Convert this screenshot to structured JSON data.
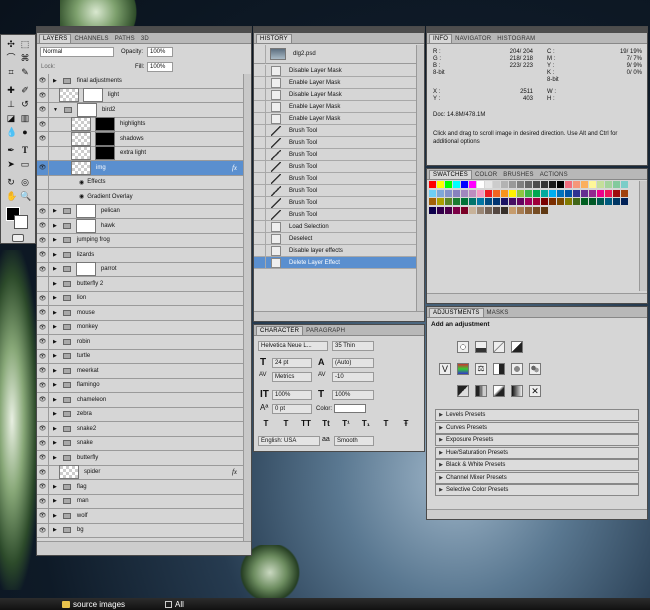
{
  "layers_panel": {
    "tabs": [
      "LAYERS",
      "CHANNELS",
      "PATHS",
      "3D"
    ],
    "blend_mode": "Normal",
    "opacity_label": "Opacity:",
    "opacity_value": "100%",
    "lock_label": "Lock:",
    "fill_label": "Fill:",
    "fill_value": "100%",
    "layers": [
      {
        "name": "final adjustments",
        "type": "group"
      },
      {
        "name": "light",
        "type": "layer-mask"
      },
      {
        "name": "bird2",
        "type": "group-open"
      },
      {
        "name": "highlights",
        "type": "sub-mask"
      },
      {
        "name": "shadows",
        "type": "sub-mask"
      },
      {
        "name": "extra light",
        "type": "sub-mask"
      },
      {
        "name": "img",
        "type": "selected"
      },
      {
        "name": "Effects",
        "type": "effect"
      },
      {
        "name": "Gradient Overlay",
        "type": "effect2"
      },
      {
        "name": "pelican",
        "type": "group-mask"
      },
      {
        "name": "hawk",
        "type": "group-mask"
      },
      {
        "name": "jumping frog",
        "type": "group"
      },
      {
        "name": "lizards",
        "type": "group"
      },
      {
        "name": "parrot",
        "type": "group-mask"
      },
      {
        "name": "butterfly 2",
        "type": "group"
      },
      {
        "name": "lion",
        "type": "group"
      },
      {
        "name": "mouse",
        "type": "group"
      },
      {
        "name": "monkey",
        "type": "group"
      },
      {
        "name": "robin",
        "type": "group"
      },
      {
        "name": "turtle",
        "type": "group"
      },
      {
        "name": "meerkat",
        "type": "group"
      },
      {
        "name": "flamingo",
        "type": "group"
      },
      {
        "name": "chameleon",
        "type": "group"
      },
      {
        "name": "zebra",
        "type": "group"
      },
      {
        "name": "snake2",
        "type": "group"
      },
      {
        "name": "snake",
        "type": "group"
      },
      {
        "name": "butterfly",
        "type": "group"
      },
      {
        "name": "spider",
        "type": "layer-fx"
      },
      {
        "name": "flag",
        "type": "group"
      },
      {
        "name": "man",
        "type": "group"
      },
      {
        "name": "wolf",
        "type": "group"
      },
      {
        "name": "bg",
        "type": "group"
      }
    ],
    "fx_label": "fx"
  },
  "history_panel": {
    "tab": "HISTORY",
    "snapshot": "dlg2.psd",
    "items": [
      {
        "label": "Disable Layer Mask",
        "icon": "doc"
      },
      {
        "label": "Enable Layer Mask",
        "icon": "doc"
      },
      {
        "label": "Disable Layer Mask",
        "icon": "doc"
      },
      {
        "label": "Enable Layer Mask",
        "icon": "doc"
      },
      {
        "label": "Enable Layer Mask",
        "icon": "doc"
      },
      {
        "label": "Brush Tool",
        "icon": "brush"
      },
      {
        "label": "Brush Tool",
        "icon": "brush"
      },
      {
        "label": "Brush Tool",
        "icon": "brush"
      },
      {
        "label": "Brush Tool",
        "icon": "brush"
      },
      {
        "label": "Brush Tool",
        "icon": "brush"
      },
      {
        "label": "Brush Tool",
        "icon": "brush"
      },
      {
        "label": "Brush Tool",
        "icon": "brush"
      },
      {
        "label": "Brush Tool",
        "icon": "brush"
      },
      {
        "label": "Load Selection",
        "icon": "doc"
      },
      {
        "label": "Deselect",
        "icon": "doc"
      },
      {
        "label": "Disable layer effects",
        "icon": "doc"
      },
      {
        "label": "Delete Layer Effect",
        "icon": "doc"
      }
    ]
  },
  "character_panel": {
    "tabs": [
      "CHARACTER",
      "PARAGRAPH"
    ],
    "font_family": "Helvetica Neue L...",
    "font_style": "35 Thin",
    "font_size": "24 pt",
    "leading": "(Auto)",
    "kerning": "Metrics",
    "tracking": "-10",
    "vscale": "100%",
    "hscale": "100%",
    "baseline": "0 pt",
    "color_label": "Color:",
    "language": "English: USA",
    "aa_prefix": "aa",
    "antialias": "Smooth",
    "style_buttons": [
      "T",
      "T",
      "TT",
      "Tt",
      "T¹",
      "T₁",
      "T",
      "Ŧ"
    ]
  },
  "info_panel": {
    "tabs": [
      "INFO",
      "NAVIGATOR",
      "HISTOGRAM"
    ],
    "r_label": "R :",
    "g_label": "G :",
    "b_label": "B :",
    "r": "204/ 204",
    "g": "218/ 218",
    "b": "223/ 223",
    "c_label": "C :",
    "m_label": "M :",
    "y_label": "Y :",
    "k_label": "K :",
    "c": "19/ 19%",
    "m": "7/ 7%",
    "y": "9/ 9%",
    "k": "0/ 0%",
    "bitdepth": "8-bit",
    "x_label": "X :",
    "y2_label": "Y :",
    "x": "2511",
    "y2": "403",
    "w_label": "W :",
    "h_label": "H :",
    "doc": "Doc: 14.8M/478.1M",
    "hint": "Click and drag to scroll image in desired direction.  Use Alt and Ctrl for additional options"
  },
  "swatches_panel": {
    "tabs": [
      "SWATCHES",
      "COLOR",
      "BRUSHES",
      "ACTIONS"
    ]
  },
  "adjustments_panel": {
    "tabs": [
      "ADJUSTMENTS",
      "MASKS"
    ],
    "heading": "Add an adjustment",
    "presets": [
      "Levels Presets",
      "Curves Presets",
      "Exposure Presets",
      "Hue/Saturation Presets",
      "Black & White Presets",
      "Channel Mixer Presets",
      "Selective Color Presets"
    ]
  },
  "taskbar": {
    "folder": "source images",
    "all": "All"
  },
  "colors": {
    "selection": "#5a8fcf",
    "panel": "#d6d6d6"
  }
}
